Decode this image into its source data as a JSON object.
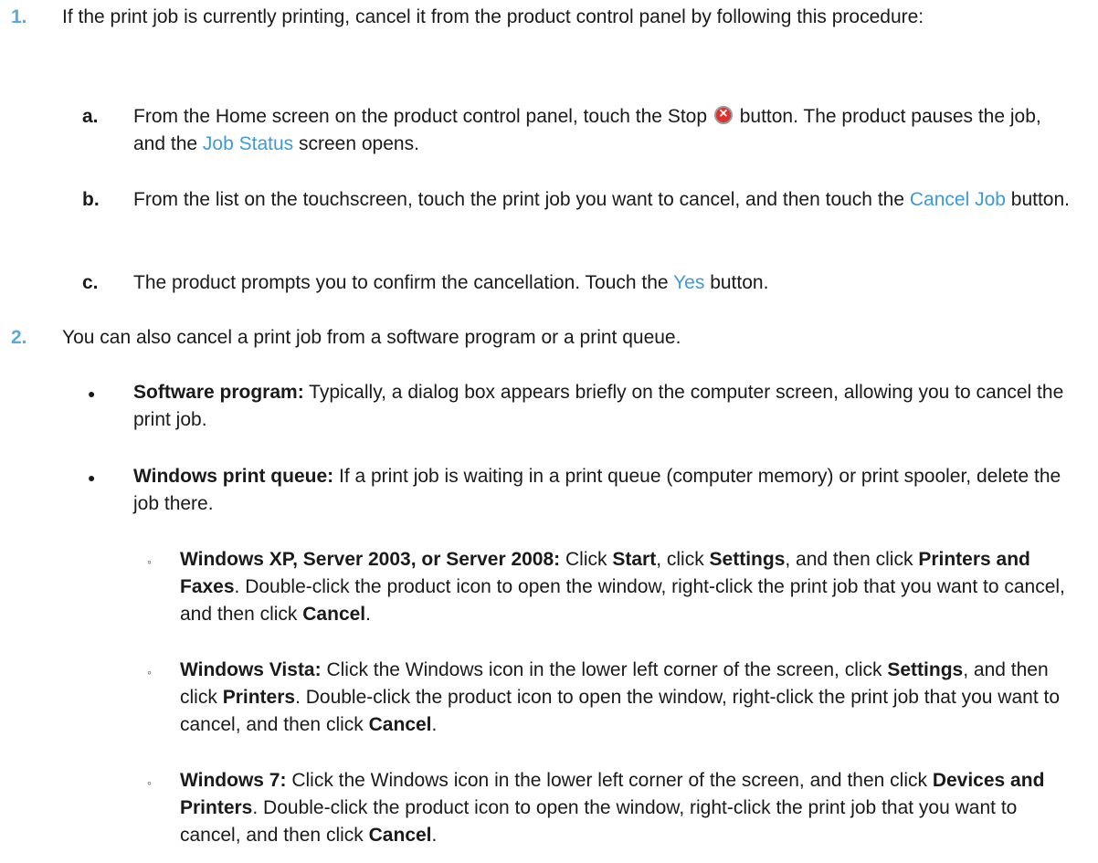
{
  "steps": [
    {
      "number": "1.",
      "text": "If the print job is currently printing, cancel it from the product control panel by following this procedure:",
      "substeps": [
        {
          "letter": "a.",
          "t1": "From the Home screen on the product control panel, touch the Stop",
          "icon": "stop-icon",
          "t2": "button. The product pauses the job, and the",
          "ui": "Job Status",
          "t3": "screen opens."
        },
        {
          "letter": "b.",
          "t1": "From the list on the touchscreen, touch the print job you want to cancel, and then touch the",
          "ui": "Cancel Job",
          "t2": "button."
        },
        {
          "letter": "c.",
          "t1": "The product prompts you to confirm the cancellation. Touch the",
          "ui": "Yes",
          "t2": "button."
        }
      ]
    },
    {
      "number": "2.",
      "text": "You can also cancel a print job from a software program or a print queue.",
      "bullets": [
        {
          "title": "Software program:",
          "text": "Typically, a dialog box appears briefly on the computer screen, allowing you to cancel the print job."
        },
        {
          "title": "Windows print queue:",
          "text": "If a print job is waiting in a print queue (computer memory) or print spooler, delete the job there.",
          "subitems": [
            {
              "title": "Windows XP, Server 2003, or Server 2008:",
              "t1": "Click",
              "b1": "Start",
              "t2": ", click",
              "b2": "Settings",
              "t3": ", and then click",
              "b3": "Printers and Faxes",
              "t4": ". Double-click the product icon to open the window, right-click the print job that you want to cancel, and then click",
              "b4": "Cancel",
              "t5": "."
            },
            {
              "title": "Windows Vista:",
              "t1": "Click the Windows icon in the lower left corner of the screen, click",
              "b1": "Settings",
              "t2": ", and then click",
              "b2": "Printers",
              "t3": ". Double-click the product icon to open the window, right-click the print job that you want to cancel, and then click",
              "b3": "Cancel",
              "t4": "."
            },
            {
              "title": "Windows 7:",
              "t1": "Click the Windows icon in the lower left corner of the screen, and then click",
              "b1": "Devices and Printers",
              "t2": ". Double-click the product icon to open the window, right-click the print job that you want to cancel, and then click",
              "b2": "Cancel",
              "t3": "."
            }
          ]
        }
      ]
    }
  ]
}
